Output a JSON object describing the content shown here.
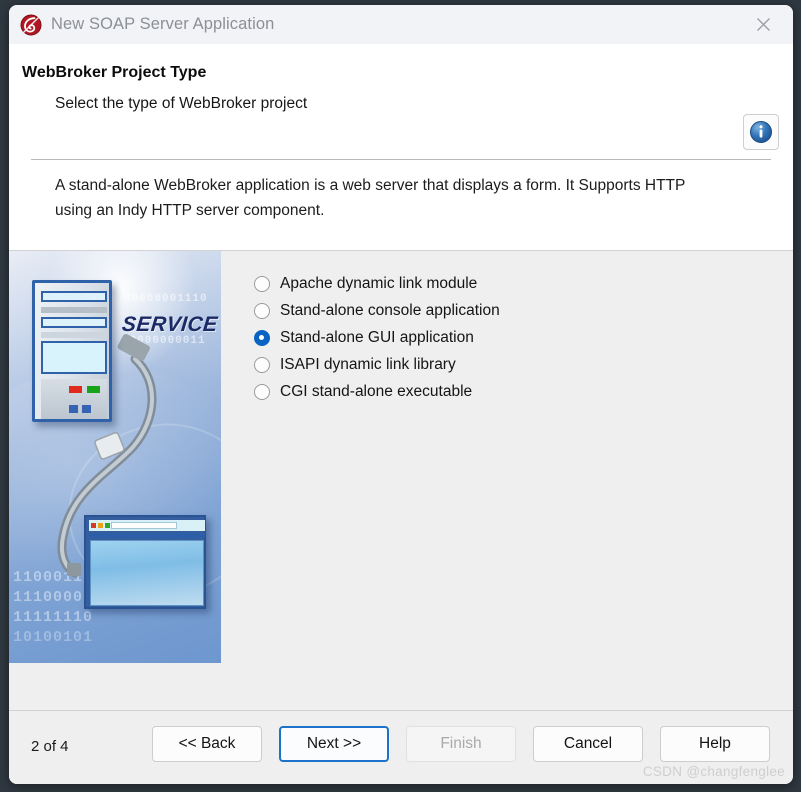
{
  "window": {
    "title": "New SOAP Server Application",
    "app_icon": "delphi-logo-icon",
    "close_icon": "close-icon"
  },
  "header": {
    "heading": "WebBroker Project Type",
    "subheading": "Select the type of WebBroker project",
    "description": "A stand-alone WebBroker application is a web server that displays a form. It Supports HTTP using an Indy HTTP server component.",
    "info_icon": "info-icon"
  },
  "illustration": {
    "service_label": "SERVICE",
    "binary_top": "00000001110",
    "binary_top2": "00000000011",
    "binary_rows": [
      "11000110",
      "11100001",
      "11111110",
      "10100101"
    ]
  },
  "options": {
    "items": [
      {
        "label": "Apache dynamic link module",
        "checked": false
      },
      {
        "label": "Stand-alone console application",
        "checked": false
      },
      {
        "label": "Stand-alone GUI application",
        "checked": true
      },
      {
        "label": "ISAPI dynamic link library",
        "checked": false
      },
      {
        "label": "CGI stand-alone executable",
        "checked": false
      }
    ]
  },
  "footer": {
    "step_counter": "2 of 4",
    "buttons": [
      {
        "label": "<< Back",
        "state": "normal"
      },
      {
        "label": "Next >>",
        "state": "focused"
      },
      {
        "label": "Finish",
        "state": "disabled"
      },
      {
        "label": "Cancel",
        "state": "normal"
      },
      {
        "label": "Help",
        "state": "normal"
      }
    ]
  },
  "watermark": "CSDN @changfenglee",
  "colors": {
    "accent_blue": "#0a63c2",
    "focus_blue": "#1a73c8",
    "frame_dark": "#2f3740",
    "panel_gray": "#efefef",
    "logo_red": "#b01722"
  }
}
